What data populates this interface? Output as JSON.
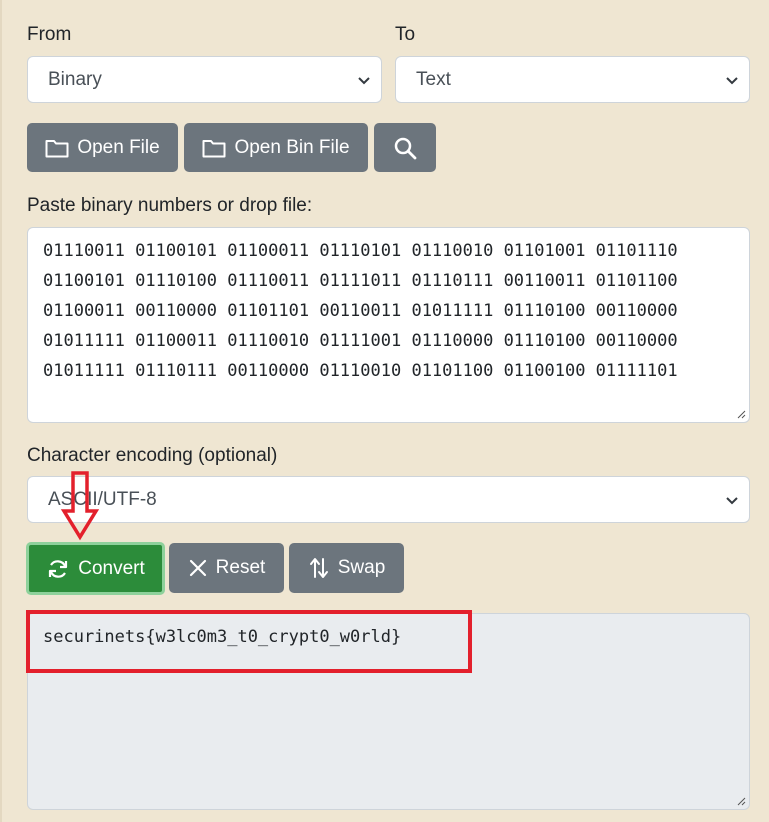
{
  "from": {
    "label": "From",
    "selected": "Binary"
  },
  "to": {
    "label": "To",
    "selected": "Text"
  },
  "toolbar": {
    "open_file": "Open File",
    "open_bin_file": "Open Bin File",
    "search_icon": "search-icon"
  },
  "input": {
    "label": "Paste binary numbers or drop file:",
    "lines": [
      "01110011 01100101 01100011 01110101 01110010 01101001 01101110",
      "01100101 01110100 01110011 01111011 01110111 00110011 01101100",
      "01100011 00110000 01101101 00110011 01011111 01110100 00110000",
      "01011111 01100011 01110010 01111001 01110000 01110100 00110000",
      "01011111 01110111 00110000 01110010 01101100 01100100 01111101"
    ]
  },
  "encoding": {
    "label": "Character encoding (optional)",
    "selected": "ASCII/UTF-8"
  },
  "actions": {
    "convert": "Convert",
    "reset": "Reset",
    "swap": "Swap"
  },
  "output": {
    "value": "securinets{w3lc0m3_t0_crypt0_w0rld}"
  },
  "colors": {
    "background": "#efe6d2",
    "primary_button": "#2c8c3a",
    "secondary_button": "#6c757d",
    "annotation": "#e3202c"
  }
}
